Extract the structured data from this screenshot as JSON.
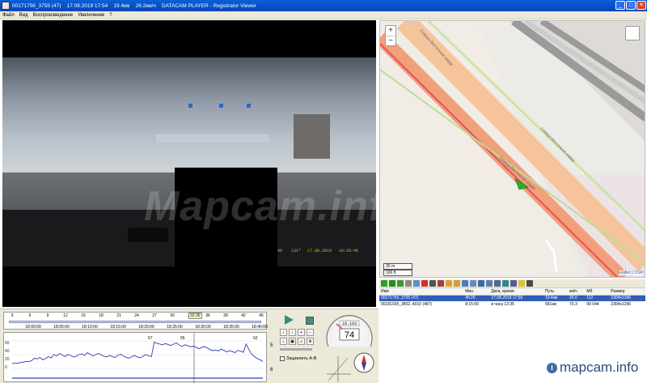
{
  "window": {
    "title": "00171756_3755 (47)    17.08.2019 17:54    19.4км    26.2км/ч    DATACAM PLAYER - Registrator Viewer",
    "buttons": [
      "_",
      "□",
      "✕"
    ]
  },
  "menu": [
    "Файл",
    "Вид",
    "Воспроизведение",
    "Увеличение",
    "?"
  ],
  "video": {
    "watermark": "Mapcam.info",
    "osd_left": "49",
    "osd_mid": "131*",
    "osd_date": "17.08.2019",
    "osd_time": "18:28:48"
  },
  "map": {
    "zoom_in": "+",
    "zoom_out": "−",
    "scale_m": "30 m",
    "scale_ft": "100 ft",
    "road_label_1": "Северо-Восточная хорда",
    "road_label_2": "Северо-Восточная хорда",
    "road_label_3": "Северо-Восточная хорда",
    "attribution_leaflet": "Leaflet",
    "attribution_osm": "OSM",
    "colors": {
      "road": "#f0a07a",
      "route": "#e8505a",
      "rail": "#9a9a9a",
      "marker": "#23b523"
    }
  },
  "tracks": {
    "columns": [
      "Имя",
      "Мин.",
      "Дата, время",
      "Путь",
      "км/ч",
      "Мб",
      "Размер"
    ],
    "rows": [
      [
        "00171756_3755 (47)",
        "45:26",
        "17.08.2019 17:56",
        "19.4км",
        "26.0",
        "112",
        "2304x1296"
      ],
      [
        "00181035_3802..4010 (487)",
        "8:15:00",
        "в часа 13:35",
        "581км",
        "70.3",
        "99 044",
        "2304x1296"
      ]
    ]
  },
  "timeline": {
    "ticks": [
      "3",
      "6",
      "9",
      "12",
      "15",
      "18",
      "21",
      "24",
      "27",
      "30",
      "33",
      "36",
      "39",
      "42",
      "45"
    ],
    "current": "32:30",
    "times": [
      "18:00:00",
      "18:05:00",
      "18:10:00",
      "18:15:00",
      "18:20:00",
      "18:25:00",
      "18:30:00",
      "18:35:00",
      "18:40:00"
    ]
  },
  "graph": {
    "y_labels": [
      "60",
      "40",
      "20",
      "0"
    ],
    "peaks": [
      "67",
      "65",
      "62"
    ],
    "speed_series": [
      12,
      14,
      13,
      15,
      16,
      18,
      17,
      20,
      26,
      24,
      28,
      22,
      25,
      30,
      27,
      35,
      32,
      38,
      34,
      30,
      36,
      33,
      29,
      31,
      35,
      37,
      33,
      40,
      36,
      32,
      35,
      38,
      34,
      31,
      29,
      33,
      30,
      28,
      34,
      36,
      31,
      28,
      26,
      30,
      33,
      29,
      27,
      31,
      35,
      32,
      30,
      67,
      64,
      62,
      60,
      63,
      61,
      58,
      62,
      65,
      59,
      56,
      60,
      58,
      55,
      57,
      54,
      50,
      53,
      56,
      52,
      48,
      45,
      47,
      44,
      49,
      46,
      42,
      45,
      43,
      40,
      46,
      44,
      41,
      62,
      48,
      36,
      30,
      25,
      22,
      18
    ]
  },
  "playback": {
    "side_top": "5",
    "side_bottom": "6",
    "loop_label": "Зациклить A-B",
    "speed_value": "74",
    "odometer": "18.193"
  },
  "brand": "mapcam.info"
}
